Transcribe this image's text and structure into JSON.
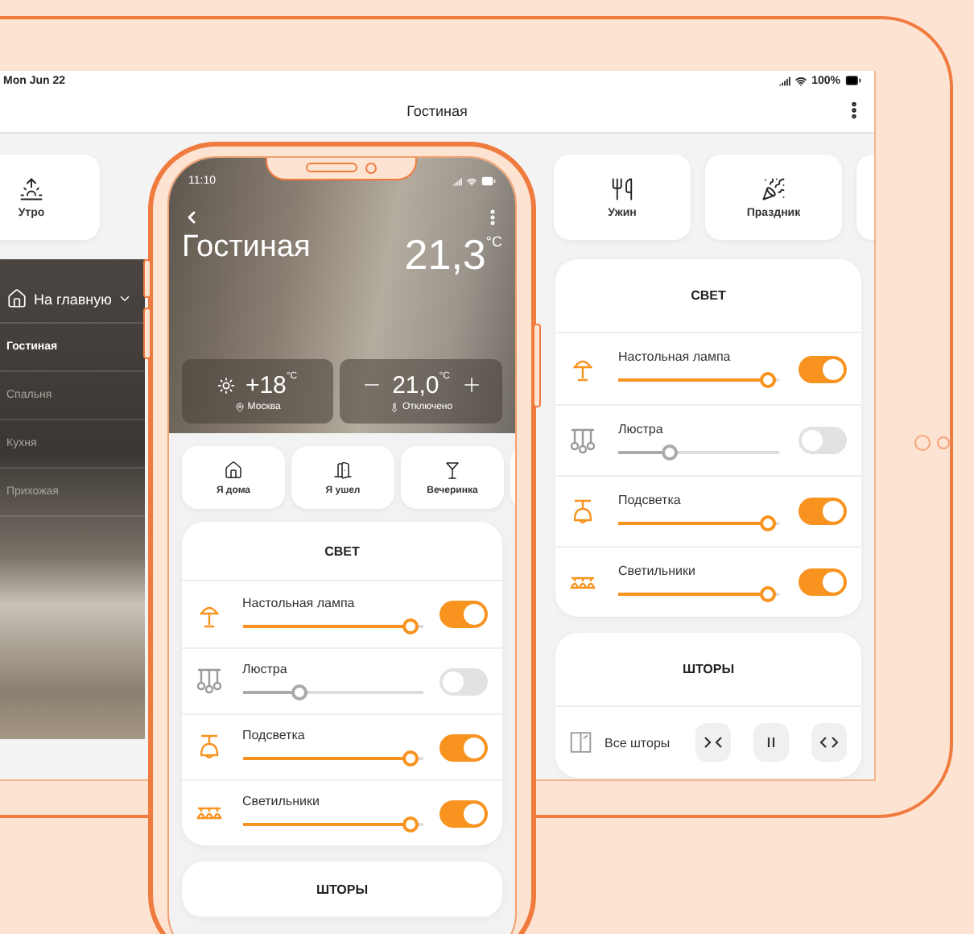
{
  "tablet": {
    "date": "Mon Jun 22",
    "battery": "100%",
    "title": "Гостиная",
    "scenes": [
      {
        "kind": "sunrise",
        "label": "Утро"
      },
      {
        "kind": "dinner",
        "label": "Ужин"
      },
      {
        "kind": "party",
        "label": "Праздник"
      }
    ],
    "menu": {
      "home": "На главную",
      "rooms": [
        {
          "label": "Гостиная",
          "selected": true
        },
        {
          "label": "Спальня",
          "selected": false
        },
        {
          "label": "Кухня",
          "selected": false
        },
        {
          "label": "Прихожая",
          "selected": false
        }
      ]
    },
    "light": {
      "title": "СВЕТ",
      "lamps": [
        {
          "kind": "table-lamp",
          "name": "Настольная лампа",
          "level": 0.98,
          "on": true
        },
        {
          "kind": "chandelier",
          "name": "Люстра",
          "level": 0.37,
          "on": false
        },
        {
          "kind": "pendant",
          "name": "Подсветка",
          "level": 0.98,
          "on": true
        },
        {
          "kind": "spots",
          "name": "Светильники",
          "level": 0.98,
          "on": true
        }
      ]
    },
    "blinds": {
      "title": "ШТОРЫ",
      "label": "Все шторы",
      "controls": [
        {
          "kind": "close"
        },
        {
          "kind": "pause"
        },
        {
          "kind": "open"
        }
      ]
    }
  },
  "phone": {
    "time": "11:10",
    "room": "Гостиная",
    "room_temp": "21,3$^{°C}$",
    "outdoor_temp": "+18$^{°C}$",
    "city": "Москва",
    "set_temp": "21,0$^{°C}$",
    "heating": "Отключено",
    "scenes": [
      {
        "kind": "home",
        "label": "Я дома"
      },
      {
        "kind": "door",
        "label": "Я ушел"
      },
      {
        "kind": "cocktail",
        "label": "Вечеринка"
      }
    ],
    "light": {
      "title": "СВЕТ",
      "lamps": [
        {
          "kind": "table-lamp",
          "name": "Настольная лампа",
          "level": 0.98,
          "on": true
        },
        {
          "kind": "chandelier",
          "name": "Люстра",
          "level": 0.36,
          "on": false
        },
        {
          "kind": "pendant",
          "name": "Подсветка",
          "level": 0.98,
          "on": true
        },
        {
          "kind": "spots",
          "name": "Светильники",
          "level": 0.98,
          "on": true
        }
      ]
    },
    "blinds": {
      "title": "ШТОРЫ"
    }
  }
}
